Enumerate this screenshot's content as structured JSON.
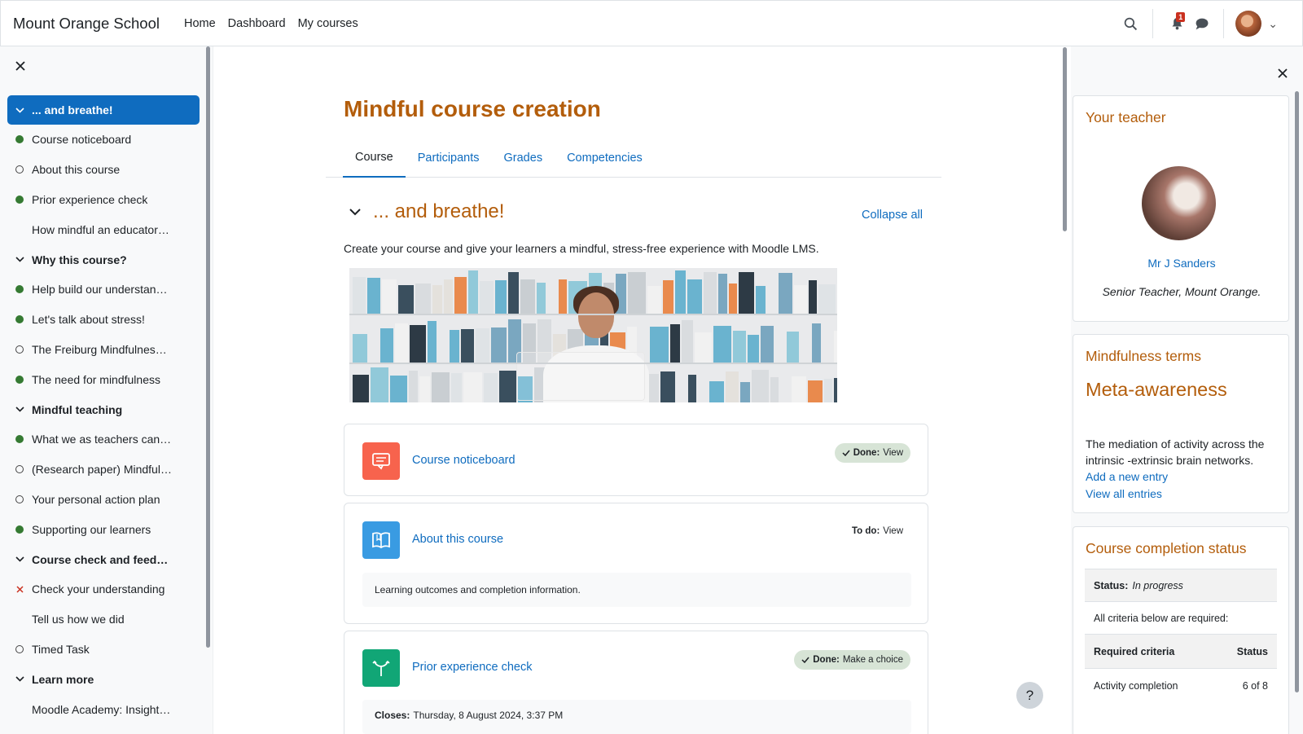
{
  "site": {
    "name": "Mount Orange School"
  },
  "topnav": {
    "items": [
      "Home",
      "Dashboard",
      "My courses"
    ],
    "notification_count": "1"
  },
  "index": {
    "items": [
      {
        "label": "... and breathe!",
        "kind": "section",
        "active": true
      },
      {
        "label": "Course noticeboard",
        "kind": "done"
      },
      {
        "label": "About this course",
        "kind": "todo"
      },
      {
        "label": "Prior experience check",
        "kind": "done"
      },
      {
        "label": "How mindful an educator…",
        "kind": "none"
      },
      {
        "label": "Why this course?",
        "kind": "section"
      },
      {
        "label": "Help build our understan…",
        "kind": "done"
      },
      {
        "label": "Let's talk about stress!",
        "kind": "done"
      },
      {
        "label": "The Freiburg Mindfulnes…",
        "kind": "todo"
      },
      {
        "label": "The need for mindfulness",
        "kind": "done"
      },
      {
        "label": "Mindful teaching",
        "kind": "section"
      },
      {
        "label": "What we as teachers can…",
        "kind": "done"
      },
      {
        "label": "(Research paper) Mindful…",
        "kind": "todo"
      },
      {
        "label": "Your personal action plan",
        "kind": "todo"
      },
      {
        "label": "Supporting our learners",
        "kind": "done"
      },
      {
        "label": "Course check and feed…",
        "kind": "section"
      },
      {
        "label": "Check your understanding",
        "kind": "failed"
      },
      {
        "label": "Tell us how we did",
        "kind": "none"
      },
      {
        "label": "Timed Task",
        "kind": "todo"
      },
      {
        "label": "Learn more",
        "kind": "section"
      },
      {
        "label": "Moodle Academy: Insight…",
        "kind": "none"
      }
    ]
  },
  "course": {
    "title": "Mindful course creation",
    "tabs": [
      "Course",
      "Participants",
      "Grades",
      "Competencies"
    ],
    "section_title": "... and breathe!",
    "collapse_all": "Collapse all",
    "summary": "Create your course and give your learners a mindful, stress-free experience with Moodle LMS.",
    "activities": [
      {
        "name": "Course noticeboard",
        "status_label": "Done:",
        "status_action": "View"
      },
      {
        "name": "About this course",
        "status_label": "To do:",
        "status_action": "View",
        "description": "Learning outcomes and completion information."
      },
      {
        "name": "Prior experience check",
        "status_label": "Done:",
        "status_action": "Make a choice",
        "closes_label": "Closes:",
        "closes_value": "Thursday, 8 August 2024, 3:37 PM"
      }
    ],
    "help": "?"
  },
  "teacher_block": {
    "title": "Your teacher",
    "name": "Mr J Sanders",
    "role": "Senior Teacher, Mount Orange."
  },
  "terms_block": {
    "title": "Mindfulness terms",
    "term": "Meta-awareness",
    "definition": "The mediation of activity across the intrinsic -extrinsic brain networks.",
    "add_link": "Add a new entry",
    "view_link": "View all entries"
  },
  "completion_block": {
    "title": "Course completion status",
    "status_label": "Status:",
    "status_value": "In progress",
    "criteria_note": "All criteria below are required:",
    "col_criteria": "Required criteria",
    "col_status": "Status",
    "row_name": "Activity completion",
    "row_value": "6 of 8"
  },
  "colors": {
    "brand_orange": "#b35d0b",
    "link_blue": "#0f6cbf",
    "done_green": "#357a32",
    "noticeboard": "#f7634d",
    "book": "#399be2",
    "choice": "#11a676"
  }
}
